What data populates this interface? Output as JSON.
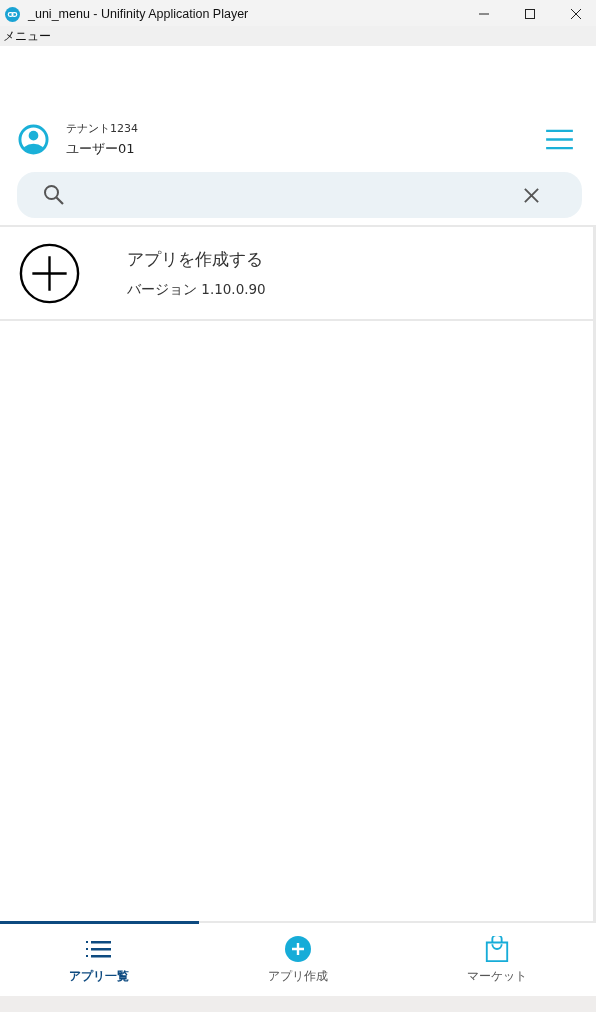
{
  "window": {
    "title": "_uni_menu - Unifinity Application Player"
  },
  "menu_bar": [
    "メニュー"
  ],
  "header": {
    "tenant": "テナント1234",
    "user": "ユーザー01"
  },
  "apps": [
    {
      "title": "アプリを作成する",
      "version": "バージョン 1.10.0.90"
    }
  ],
  "tabs": [
    {
      "label": "アプリ一覧",
      "kind": "list",
      "selected": true
    },
    {
      "label": "アプリ作成",
      "kind": "create",
      "selected": false
    },
    {
      "label": "マーケット",
      "kind": "market",
      "selected": false
    }
  ]
}
